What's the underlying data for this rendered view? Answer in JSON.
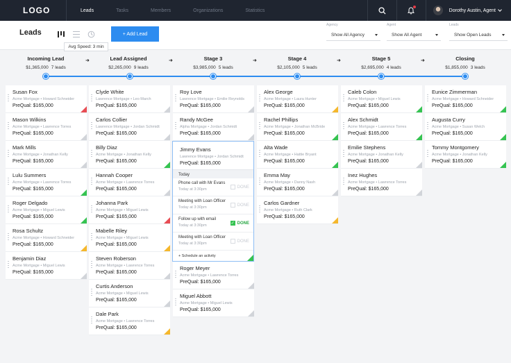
{
  "nav": {
    "logo": "LOGO",
    "links": [
      {
        "label": "Leads",
        "active": true
      },
      {
        "label": "Tasks"
      },
      {
        "label": "Members"
      },
      {
        "label": "Organizations"
      },
      {
        "label": "Statistics"
      }
    ],
    "user": "Dorothy Austin, Agent"
  },
  "header": {
    "title": "Leads",
    "add_button": "+ Add Lead",
    "tooltip": "Avg Speed: 3 min",
    "filters": [
      {
        "label": "Agency",
        "value": "Show All Agency"
      },
      {
        "label": "Agent",
        "value": "Show All Agent"
      },
      {
        "label": "Leads",
        "value": "Show Open Leads"
      }
    ]
  },
  "stages": [
    {
      "name": "Incoming Lead",
      "amount": "$1,365,000",
      "count": "7 leads"
    },
    {
      "name": "Lead Assigned",
      "amount": "$2,265,000",
      "count": "9 leads"
    },
    {
      "name": "Stage 3",
      "amount": "$3,985,000",
      "count": "5 leads"
    },
    {
      "name": "Stage 4",
      "amount": "$2,105,000",
      "count": "5 leads"
    },
    {
      "name": "Stage 5",
      "amount": "$2,695,000",
      "count": "4 leads"
    },
    {
      "name": "Closing",
      "amount": "$1,855,000",
      "count": "3 leads"
    }
  ],
  "columns": [
    {
      "cards": [
        {
          "name": "Susan Fox",
          "org": "Acme Mortgage • Howard Schneider",
          "prequal": "PreQual: $165,000",
          "status": "red"
        },
        {
          "name": "Mason Wilkins",
          "org": "Acme Mortgage • Lawrence Torres",
          "prequal": "PreQual: $165,000",
          "status": "gray"
        },
        {
          "name": "Mark Mills",
          "org": "Acme Mortgage • Jonathan Kelly",
          "prequal": "PreQual: $165,000",
          "status": "gray"
        },
        {
          "name": "Lulu Summers",
          "org": "Acme Mortgage • Lawrence Torres",
          "prequal": "PreQual: $165,000",
          "status": "green"
        },
        {
          "name": "Roger Delgado",
          "org": "Acme Mortgage • Miguel Lewis",
          "prequal": "PreQual: $165,000",
          "status": "green"
        },
        {
          "name": "Rosa Schultz",
          "org": "Acme Mortgage • Howard Schneider",
          "prequal": "PreQual: $165,000",
          "status": "yellow"
        },
        {
          "name": "Benjamin Diaz",
          "org": "Acme Mortgage • Miguel Lewis",
          "prequal": "PreQual: $165,000",
          "status": "gray"
        }
      ]
    },
    {
      "cards": [
        {
          "name": "Clyde White",
          "org": "Lawrence Mortgage • Leo March",
          "prequal": "PreQual: $165,000",
          "status": "gray"
        },
        {
          "name": "Carlos Collier",
          "org": "Lawrence Mortgage • Jordan Schmidt",
          "prequal": "PreQual: $165,000",
          "status": "gray"
        },
        {
          "name": "Billy Diaz",
          "org": "Acme Mortgage • Jonathan Kelly",
          "prequal": "PreQual: $165,000",
          "status": "green"
        },
        {
          "name": "Hannah Cooper",
          "org": "Acme Mortgage • Lawrence Torres",
          "prequal": "PreQual: $165,000",
          "status": "gray"
        },
        {
          "name": "Johanna Park",
          "org": "Acme Mortgage • Miguel Lewis",
          "prequal": "PreQual: $165,000",
          "status": "red"
        },
        {
          "name": "Mabelle Riley",
          "org": "Acme Mortgage • Miguel Lewis",
          "prequal": "PreQual: $165,000",
          "status": "yellow"
        },
        {
          "name": "Steven Roberson",
          "org": "Acme Mortgage • Lawrence Torres",
          "prequal": "PreQual: $165,000",
          "status": "gray"
        },
        {
          "name": "Curtis Anderson",
          "org": "Acme Mortgage • Miguel Lewis",
          "prequal": "PreQual: $165,000",
          "status": "gray"
        },
        {
          "name": "Dale Park",
          "org": "Acme Mortgage • Lawrence Torres",
          "prequal": "PreQual: $165,000",
          "status": "yellow"
        }
      ]
    },
    {
      "cards_before": [
        {
          "name": "Roy Love",
          "org": "Lawrence Mortgage • Emilie Reynolds",
          "prequal": "PreQual: $165,000",
          "status": "gray"
        },
        {
          "name": "Randy McGee",
          "org": "Alpha Mortgage • Jordan Schmidt",
          "prequal": "PreQual: $165,000",
          "status": "gray"
        }
      ],
      "expanded": {
        "name": "Jimmy Evans",
        "org": "Lawrence Mortgage • Jordan Schmidt",
        "prequal": "PreQual: $165,000",
        "section": "Today",
        "done_label": "DONE",
        "activities": [
          {
            "title": "Phone call with Mr Evans",
            "time": "Today at 3:30pm",
            "done": false
          },
          {
            "title": "Meeting with Loan Officer",
            "time": "Today at 3:30pm",
            "done": false
          },
          {
            "title": "Follow up with email",
            "time": "Today at 3:30pm",
            "done": true
          },
          {
            "title": "Meeting with Loan Officer",
            "time": "Today at 3:30pm",
            "done": false
          }
        ],
        "schedule": "+ Schedule an activity"
      },
      "cards_after": [
        {
          "name": "Roger Meyer",
          "org": "Acme Mortgage • Lawrence Torres",
          "prequal": "PreQual: $165,000",
          "status": "gray"
        },
        {
          "name": "Miguel Abbott",
          "org": "Acme Mortgage • Miguel Lewis",
          "prequal": "PreQual: $165,000",
          "status": "gray"
        }
      ]
    },
    {
      "cards": [
        {
          "name": "Alex George",
          "org": "Acme Mortgage • Laura Hunter",
          "prequal": "PreQual: $165,000",
          "status": "yellow"
        },
        {
          "name": "Rachel Phillips",
          "org": "Acme Mortgage • Jonathan McBride",
          "prequal": "PreQual: $165,000",
          "status": "green"
        },
        {
          "name": "Alta Wade",
          "org": "Acme Mortgage • Hattie Bryant",
          "prequal": "PreQual: $165,000",
          "status": "green"
        },
        {
          "name": "Emma May",
          "org": "Acme Mortgage • Danny Nash",
          "prequal": "PreQual: $165,000",
          "status": "gray"
        },
        {
          "name": "Carlos Gardner",
          "org": "Acme Mortgage • Ruth Clark",
          "prequal": "PreQual: $165,000",
          "status": "yellow"
        }
      ]
    },
    {
      "cards": [
        {
          "name": "Caleb Colon",
          "org": "Acme Mortgage • Miguel Lewis",
          "prequal": "PreQual: $165,000",
          "status": "green"
        },
        {
          "name": "Alex Schmidt",
          "org": "Acme Mortgage • Lawrence Torres",
          "prequal": "PreQual: $165,000",
          "status": "green"
        },
        {
          "name": "Emilie Stephens",
          "org": "Acme Mortgage • Jonathan Kelly",
          "prequal": "PreQual: $165,000",
          "status": "gray"
        },
        {
          "name": "Inez Hughes",
          "org": "Acme Mortgage • Lawrence Torres",
          "prequal": "PreQual: $165,000",
          "status": "gray"
        }
      ]
    },
    {
      "cards": [
        {
          "name": "Eunice Zimmerman",
          "org": "Acme Mortgage • Howard Schneider",
          "prequal": "PreQual: $165,000",
          "status": "green"
        },
        {
          "name": "Augusta Curry",
          "org": "Acme Mortgage • Susan Welch",
          "prequal": "PreQual: $165,000",
          "status": "green"
        },
        {
          "name": "Tommy Montgomery",
          "org": "Acme Mortgage • Jonathan Kelly",
          "prequal": "PreQual: $165,000",
          "status": "green"
        }
      ]
    }
  ],
  "colors": {
    "accent": "#2d8cf0",
    "nav_bg": "#1f2530",
    "green": "#35c351",
    "red": "#e84c53",
    "yellow": "#f5b72c",
    "gray": "#d1d4d9"
  }
}
